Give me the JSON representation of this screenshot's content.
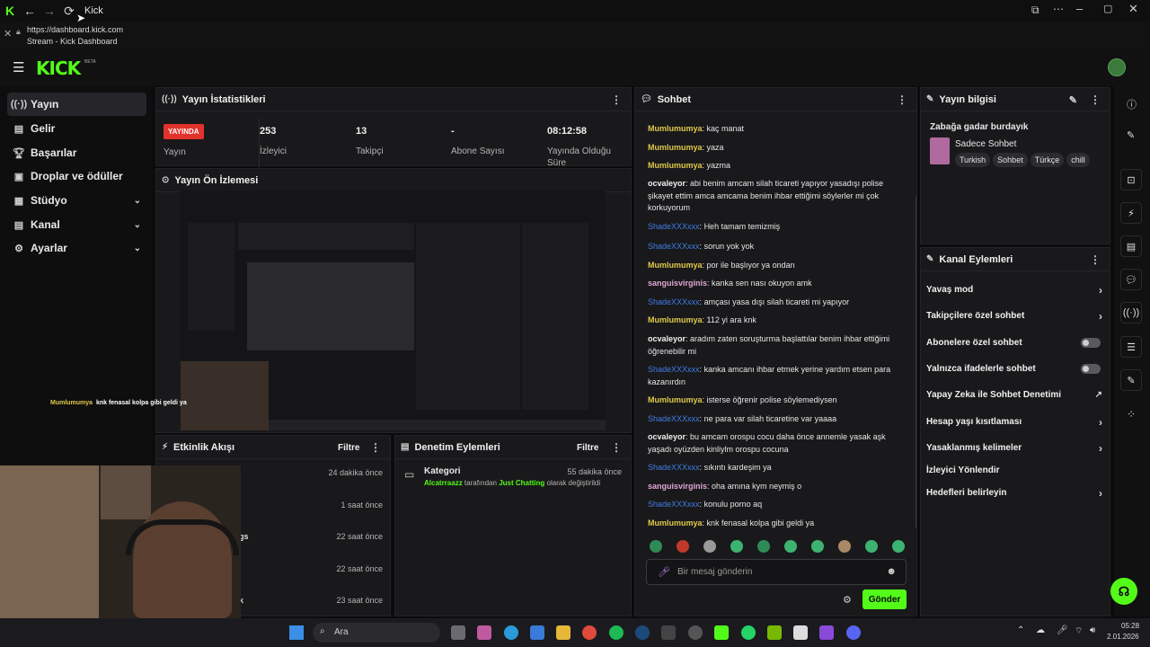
{
  "window": {
    "title": "Kick"
  },
  "tab_tooltip": {
    "url": "https://dashboard.kick.com",
    "title": "Stream - Kick Dashboard"
  },
  "colors": {
    "brand": "#53fc18",
    "live": "#e2322c",
    "bg": "#0b0b0c",
    "panel": "#19191b"
  },
  "sidebar": {
    "items": [
      {
        "label": "Yayın",
        "icon": "stream-icon"
      },
      {
        "label": "Gelir",
        "icon": "revenue-icon"
      },
      {
        "label": "Başarılar",
        "icon": "trophy-icon"
      },
      {
        "label": "Droplar ve ödüller",
        "icon": "gift-icon"
      },
      {
        "label": "Stüdyo",
        "icon": "studio-icon"
      },
      {
        "label": "Kanal",
        "icon": "channel-icon"
      },
      {
        "label": "Ayarlar",
        "icon": "gear-icon"
      }
    ]
  },
  "stats": {
    "title": "Yayın İstatistikleri",
    "live_badge": "YAYINDA",
    "live_label": "Yayın",
    "viewers": "253",
    "viewers_label": "İzleyici",
    "followers": "13",
    "followers_label": "Takipçi",
    "subs": "-",
    "subs_label": "Abone Sayısı",
    "uptime": "08:12:58",
    "uptime_label": "Yayında Olduğu Süre"
  },
  "preview": {
    "title": "Yayın Ön İzlemesi",
    "overlay_user": "Mumlumumya",
    "overlay_text": "knk fenasal kolpa gibi geldi ya"
  },
  "activity": {
    "title": "Etkinlik Akışı",
    "filter": "Filtre",
    "times": [
      "24 dakika önce",
      "1 saat önce",
      "22 saat önce",
      "22 saat önce",
      "23 saat önce"
    ],
    "partial": [
      "gs",
      "k"
    ]
  },
  "moderation": {
    "title": "Denetim Eylemleri",
    "filter": "Filtre",
    "item_title": "Kategori",
    "item_time": "55 dakika önce",
    "item_user": "Alcatrraazz",
    "item_mid": "tarafından",
    "item_cat": "Just Chatting",
    "item_end": "olarak değiştirildi"
  },
  "chat": {
    "title": "Sohbet",
    "messages": [
      {
        "user": "Mumlumumya",
        "text": "kaç manat",
        "c": "y"
      },
      {
        "user": "Mumlumumya",
        "text": "yaza",
        "c": "y"
      },
      {
        "user": "Mumlumumya",
        "text": "yazma",
        "c": "y"
      },
      {
        "user": "ocvaleyor",
        "text": "abi benim amcam silah ticareti yapıyor yasadışı polise şikayet ettim amca amcama benim ihbar ettiğimi söylerler mi çok korkuyorum",
        "c": "w"
      },
      {
        "user": "ShadeXXXxxx",
        "text": "Heh tamam temizmiş",
        "c": "b"
      },
      {
        "user": "ShadeXXXxxx",
        "text": "sorun yok yok",
        "c": "b"
      },
      {
        "user": "Mumlumumya",
        "text": "por ile başlıyor ya ondan",
        "c": "y"
      },
      {
        "user": "sanguisvirginis",
        "text": "kanka sen nası okuyon amk",
        "c": "p"
      },
      {
        "user": "ShadeXXXxxx",
        "text": "amçası yasa dışı silah ticareti mi yapıyor",
        "c": "b"
      },
      {
        "user": "Mumlumumya",
        "text": "112 yi ara knk",
        "c": "y"
      },
      {
        "user": "ocvaleyor",
        "text": "aradım zaten soruşturma başlattılar benim ihbar ettiğimi öğrenebilir mi",
        "c": "w"
      },
      {
        "user": "ShadeXXXxxx",
        "text": "kanka amcanı ihbar etmek yerine yardım etsen para kazanırdın",
        "c": "b"
      },
      {
        "user": "Mumlumumya",
        "text": "isterse öğrenir polise söylemediysen",
        "c": "y"
      },
      {
        "user": "ShadeXXXxxx",
        "text": "ne para var silah ticaretine var yaaaa",
        "c": "b"
      },
      {
        "user": "ocvaleyor",
        "text": "bu amcam orospu cocu daha önce annemle yasak aşk yaşadı oyüzden kinliylm orospu cocuna",
        "c": "w"
      },
      {
        "user": "ShadeXXXxxx",
        "text": "sıkıntı kardeşim ya",
        "c": "b"
      },
      {
        "user": "sanguisvirginis",
        "text": "oha amına kym neymiş o",
        "c": "p"
      },
      {
        "user": "ShadeXXXxxx",
        "text": "konulu porno aq",
        "c": "b"
      },
      {
        "user": "Mumlumumya",
        "text": "knk fenasal kolpa gibi geldi ya",
        "c": "y"
      }
    ],
    "input_placeholder": "Bir mesaj gönderin",
    "send": "Gönder"
  },
  "info": {
    "title": "Yayın bilgisi",
    "stream_title": "Zabağa gadar burdayık",
    "category": "Sadece Sohbet",
    "tags": [
      "Turkish",
      "Sohbet",
      "Türkçe",
      "chill"
    ]
  },
  "actions": {
    "title": "Kanal Eylemleri",
    "items": [
      {
        "label": "Yavaş mod",
        "kind": "chevron"
      },
      {
        "label": "Takipçilere özel sohbet",
        "kind": "chevron"
      },
      {
        "label": "Abonelere özel sohbet",
        "kind": "toggle"
      },
      {
        "label": "Yalnızca ifadelerle sohbet",
        "kind": "toggle"
      },
      {
        "label": "Yapay Zeka ile Sohbet Denetimi",
        "kind": "external"
      },
      {
        "label": "Hesap yaşı kısıtlaması",
        "kind": "chevron"
      },
      {
        "label": "Yasaklanmış kelimeler",
        "kind": "chevron"
      },
      {
        "label": "İzleyici Yönlendir",
        "kind": "none"
      },
      {
        "label": "Hedefleri belirleyin",
        "kind": "chevron"
      }
    ]
  },
  "taskbar": {
    "search": "Ara",
    "time": "05:28",
    "date": "2.01.2026"
  }
}
